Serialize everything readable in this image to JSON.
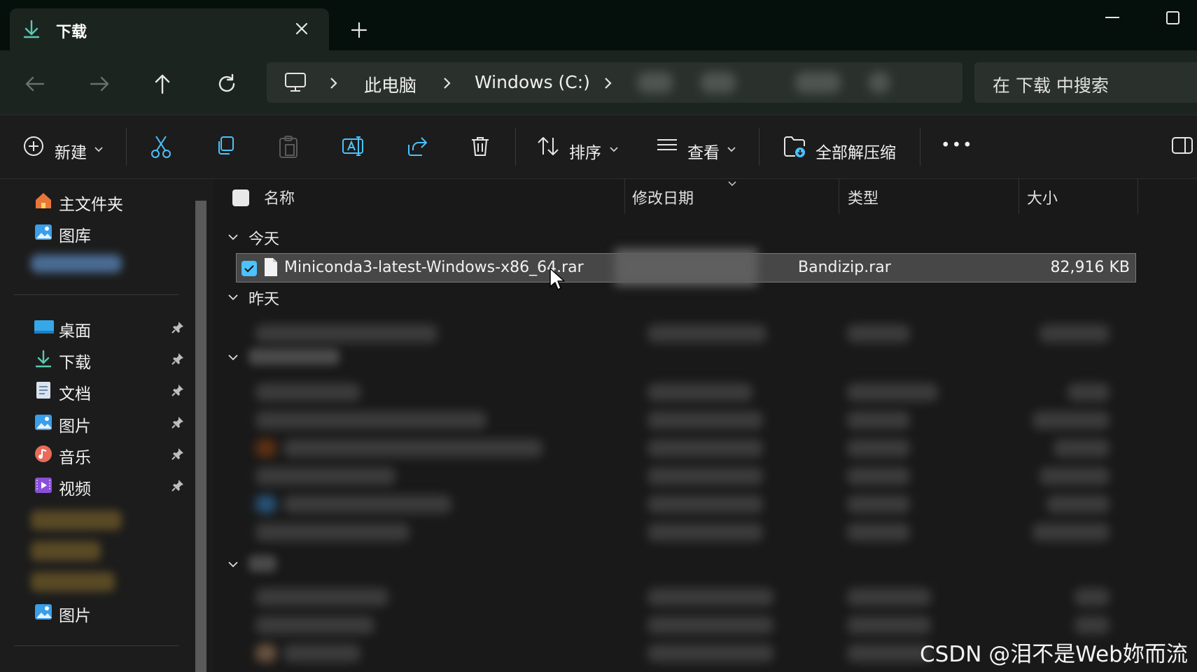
{
  "tab": {
    "title": "下载"
  },
  "address": {
    "crumbs": [
      "此电脑",
      "Windows (C:)"
    ],
    "search_placeholder": "在 下载 中搜索"
  },
  "toolbar": {
    "new_label": "新建",
    "sort_label": "排序",
    "view_label": "查看",
    "extract_label": "全部解压缩",
    "more_label": "•••"
  },
  "sidebar": {
    "top_items": [
      {
        "label": "主文件夹",
        "icon": "home-icon"
      },
      {
        "label": "图库",
        "icon": "gallery-icon"
      }
    ],
    "pinned_items": [
      {
        "label": "桌面",
        "icon": "desktop-icon"
      },
      {
        "label": "下载",
        "icon": "download-icon"
      },
      {
        "label": "文档",
        "icon": "document-icon"
      },
      {
        "label": "图片",
        "icon": "pictures-icon"
      },
      {
        "label": "音乐",
        "icon": "music-icon"
      },
      {
        "label": "视频",
        "icon": "video-icon"
      }
    ],
    "bottom_item": {
      "label": "图片",
      "icon": "pictures-icon"
    }
  },
  "columns": {
    "name": "名称",
    "date": "修改日期",
    "type": "类型",
    "size": "大小"
  },
  "groups": {
    "today": "今天",
    "yesterday": "昨天"
  },
  "selected_file": {
    "name": "Miniconda3-latest-Windows-x86_64.rar",
    "type": "Bandizip.rar",
    "size": "82,916 KB",
    "checked": true
  },
  "watermark": "CSDN @泪不是Web妳而流",
  "colors": {
    "accent": "#4cc2ff",
    "folder": "#e3b341",
    "background": "#1c1c1c"
  }
}
